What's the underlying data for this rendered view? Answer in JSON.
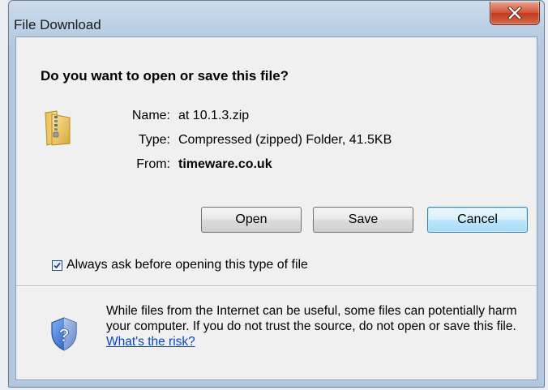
{
  "window": {
    "title": "File Download"
  },
  "dialog": {
    "heading": "Do you want to open or save this file?",
    "file": {
      "name_label": "Name:",
      "name_value": "at 10.1.3.zip",
      "type_label": "Type:",
      "type_value": "Compressed (zipped) Folder, 41.5KB",
      "from_label": "From:",
      "from_value": "timeware.co.uk"
    },
    "buttons": {
      "open": "Open",
      "save": "Save",
      "cancel": "Cancel"
    },
    "checkbox": {
      "label": "Always ask before opening this type of file",
      "checked": true
    },
    "warning": {
      "text": "While files from the Internet can be useful, some files can potentially harm your computer. If you do not trust the source, do not open or save this file.",
      "link": "What's the risk?"
    }
  },
  "icons": {
    "file": "zipped-folder-icon",
    "warning": "security-shield-icon",
    "close": "close-icon"
  },
  "colors": {
    "close_button": "#c9452a",
    "default_button_border": "#3c7fb1",
    "link": "#0645c9"
  }
}
